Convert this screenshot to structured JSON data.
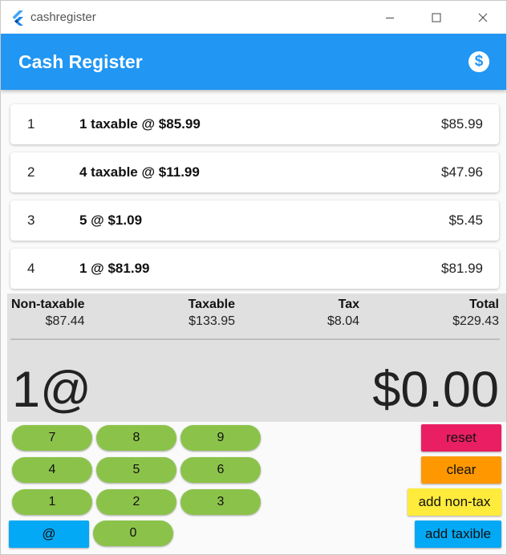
{
  "window": {
    "title": "cashregister"
  },
  "appbar": {
    "title": "Cash Register",
    "icon": "dollar-icon",
    "icon_glyph": "$",
    "color": "#2196f3"
  },
  "items": [
    {
      "num": "1",
      "desc": "1 taxable @ $85.99",
      "amount": "$85.99"
    },
    {
      "num": "2",
      "desc": "4 taxable @ $11.99",
      "amount": "$47.96"
    },
    {
      "num": "3",
      "desc": "5 @ $1.09",
      "amount": "$5.45"
    },
    {
      "num": "4",
      "desc": "1 @ $81.99",
      "amount": "$81.99"
    }
  ],
  "summary": {
    "non_taxable_label": "Non-taxable",
    "non_taxable_value": "$87.44",
    "taxable_label": "Taxable",
    "taxable_value": "$133.95",
    "tax_label": "Tax",
    "tax_value": "$8.04",
    "total_label": "Total",
    "total_value": "$229.43"
  },
  "entry": {
    "qty": "1@",
    "amount": "$0.00"
  },
  "keypad": {
    "k7": "7",
    "k8": "8",
    "k9": "9",
    "k4": "4",
    "k5": "5",
    "k6": "6",
    "k1": "1",
    "k2": "2",
    "k3": "3",
    "at": "@",
    "k0": "0"
  },
  "actions": {
    "reset": "reset",
    "clear": "clear",
    "add_non_tax": "add non-tax",
    "add_taxable": "add taxible"
  },
  "colors": {
    "keypad_green": "#8bc34a",
    "at_button": "#03a9f4",
    "reset": "#e91e63",
    "clear": "#ff9800",
    "add_non_tax": "#ffeb3b",
    "add_taxable": "#03a9f4"
  }
}
